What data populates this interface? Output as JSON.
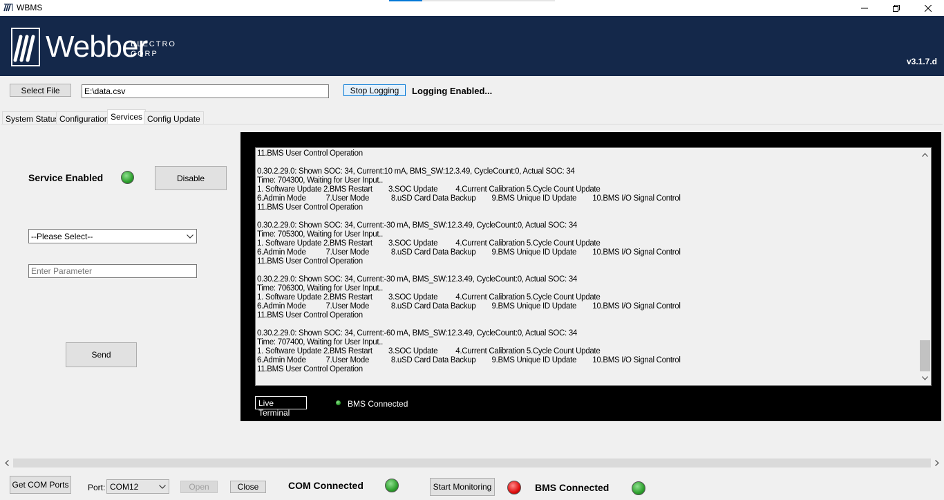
{
  "window": {
    "title": "WBMS"
  },
  "banner": {
    "brand": "Webber",
    "sub_line1": "ELECTRO",
    "sub_line2": "CORP",
    "version": "v3.1.7.d"
  },
  "file_bar": {
    "select_file_label": "Select File",
    "file_path": "E:\\data.csv",
    "stop_logging_label": "Stop Logging",
    "logging_status": "Logging Enabled..."
  },
  "tabs": [
    {
      "label": "System Status"
    },
    {
      "label": "Configuration"
    },
    {
      "label": "Services"
    },
    {
      "label": "Config Update"
    }
  ],
  "services": {
    "status_label": "Service Enabled",
    "status_led": "green",
    "disable_label": "Disable",
    "select_value": "--Please Select--",
    "parameter_placeholder": "Enter Parameter",
    "send_label": "Send"
  },
  "terminal": {
    "lines": [
      "11.BMS User Control Operation",
      "",
      "0.30.2.29.0: Shown SOC: 34, Current:10 mA, BMS_SW:12.3.49, CycleCount:0, Actual SOC: 34",
      "Time: 704300, Waiting for User Input..",
      "1. Software Update 2.BMS Restart        3.SOC Update         4.Current Calibration 5.Cycle Count Update",
      "6.Admin Mode          7.User Mode           8.uSD Card Data Backup        9.BMS Unique ID Update        10.BMS I/O Signal Control",
      "11.BMS User Control Operation",
      "",
      "0.30.2.29.0: Shown SOC: 34, Current:-30 mA, BMS_SW:12.3.49, CycleCount:0, Actual SOC: 34",
      "Time: 705300, Waiting for User Input..",
      "1. Software Update 2.BMS Restart        3.SOC Update         4.Current Calibration 5.Cycle Count Update",
      "6.Admin Mode          7.User Mode           8.uSD Card Data Backup        9.BMS Unique ID Update        10.BMS I/O Signal Control",
      "11.BMS User Control Operation",
      "",
      "0.30.2.29.0: Shown SOC: 34, Current:-30 mA, BMS_SW:12.3.49, CycleCount:0, Actual SOC: 34",
      "Time: 706300, Waiting for User Input..",
      "1. Software Update 2.BMS Restart        3.SOC Update         4.Current Calibration 5.Cycle Count Update",
      "6.Admin Mode          7.User Mode           8.uSD Card Data Backup        9.BMS Unique ID Update        10.BMS I/O Signal Control",
      "11.BMS User Control Operation",
      "",
      "0.30.2.29.0: Shown SOC: 34, Current:-60 mA, BMS_SW:12.3.49, CycleCount:0, Actual SOC: 34",
      "Time: 707400, Waiting for User Input..",
      "1. Software Update 2.BMS Restart        3.SOC Update         4.Current Calibration 5.Cycle Count Update",
      "6.Admin Mode          7.User Mode           8.uSD Card Data Backup        9.BMS Unique ID Update        10.BMS I/O Signal Control",
      "11.BMS User Control Operation"
    ],
    "live_terminal_label": "Live Terminal",
    "bms_connected_label": "BMS Connected",
    "bms_led": "green"
  },
  "bottom_bar": {
    "get_com_ports_label": "Get COM Ports",
    "port_label": "Port:",
    "port_value": "COM12",
    "open_label": "Open",
    "close_label": "Close",
    "com_status_label": "COM Connected",
    "com_led": "green",
    "start_monitoring_label": "Start Monitoring",
    "monitoring_led": "red",
    "bms_status_label": "BMS Connected",
    "bms_led": "green"
  }
}
